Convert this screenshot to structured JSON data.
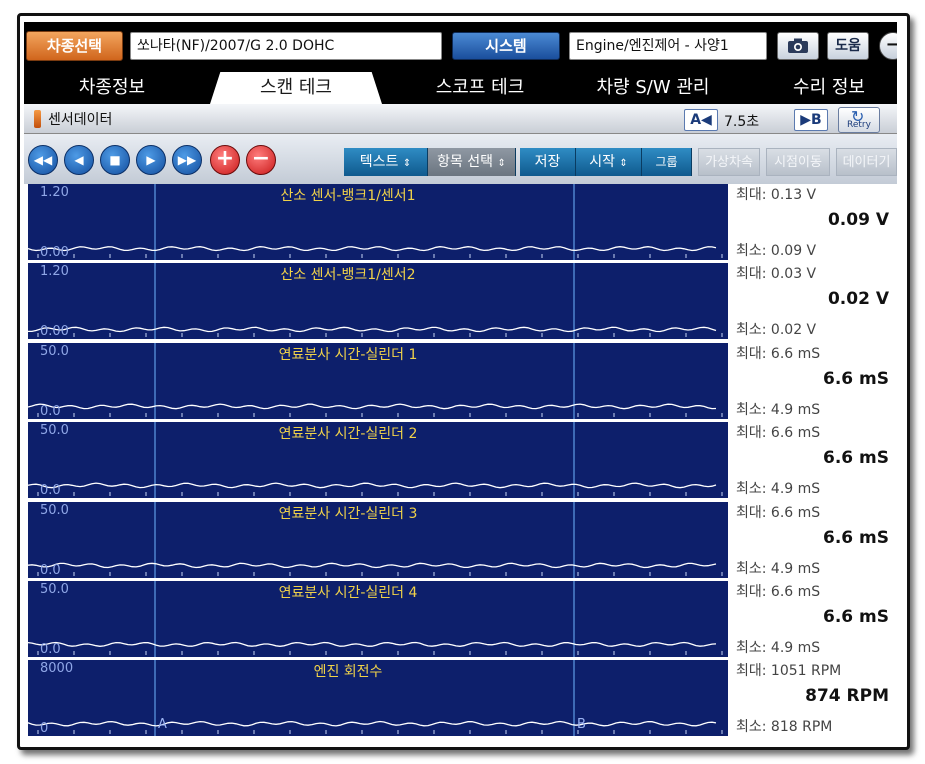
{
  "topbar": {
    "model_button": "차종선택",
    "vehicle": "쏘나타(NF)/2007/G 2.0 DOHC",
    "system_button": "시스템",
    "system_field": "Engine/엔진제어 - 사양1",
    "camera_icon": "camera-icon",
    "help_icon": "도움"
  },
  "tabs": [
    {
      "label": "차종정보"
    },
    {
      "label": "스캔 테크"
    },
    {
      "label": "스코프 테크"
    },
    {
      "label": "차량 S/W 관리"
    },
    {
      "label": "수리 정보"
    }
  ],
  "active_tab": 1,
  "sensorbar": {
    "title": "센서데이터",
    "cursor_a": "A◀",
    "time": "7.5초",
    "cursor_b": "▶B",
    "retry": "Retry"
  },
  "controls": {
    "text_button": "텍스트",
    "item_select": "항목 선택",
    "save": "저장",
    "start": "시작",
    "group": "그룹",
    "virtual_speed": "가상차속",
    "time_move": "시점이동",
    "data": "데이터기"
  },
  "cursor_labels": {
    "a": "A",
    "b": "B"
  },
  "chart_data": [
    {
      "type": "line",
      "title": "산소 센서-뱅크1/센서1",
      "ylim": [
        0.0,
        1.2
      ],
      "ymax_label": "1.20",
      "ymin_label": "0.00",
      "max": "최대:  0.13 V",
      "min": "최소:  0.09 V",
      "current": "0.09 V",
      "level": 0.08
    },
    {
      "type": "line",
      "title": "산소 센서-뱅크1/센서2",
      "ylim": [
        0.0,
        1.2
      ],
      "ymax_label": "1.20",
      "ymin_label": "0.00",
      "max": "최대:  0.03 V",
      "min": "최소:  0.02 V",
      "current": "0.02 V",
      "level": 0.02
    },
    {
      "type": "line",
      "title": "연료분사 시간-실린더 1",
      "ylim": [
        0.0,
        50.0
      ],
      "ymax_label": "50.0",
      "ymin_label": "0.0",
      "max": "최대:   6.6 mS",
      "min": "최소:   4.9 mS",
      "current": "6.6 mS",
      "level": 0.12
    },
    {
      "type": "line",
      "title": "연료분사 시간-실린더 2",
      "ylim": [
        0.0,
        50.0
      ],
      "ymax_label": "50.0",
      "ymin_label": "0.0",
      "max": "최대:   6.6 mS",
      "min": "최소:   4.9 mS",
      "current": "6.6 mS",
      "level": 0.12
    },
    {
      "type": "line",
      "title": "연료분사 시간-실린더 3",
      "ylim": [
        0.0,
        50.0
      ],
      "ymax_label": "50.0",
      "ymin_label": "0.0",
      "max": "최대:   6.6 mS",
      "min": "최소:   4.9 mS",
      "current": "6.6 mS",
      "level": 0.12
    },
    {
      "type": "line",
      "title": "연료분사 시간-실린더 4",
      "ylim": [
        0.0,
        50.0
      ],
      "ymax_label": "50.0",
      "ymin_label": "0.0",
      "max": "최대:   6.6 mS",
      "min": "최소:   4.9 mS",
      "current": "6.6 mS",
      "level": 0.12
    },
    {
      "type": "line",
      "title": "엔진 회전수",
      "ylim": [
        0,
        8000
      ],
      "ymax_label": "8000",
      "ymin_label": "0",
      "max": "최대:  1051 RPM",
      "min": "최소:  818 RPM",
      "current": "874 RPM",
      "level": 0.11
    }
  ]
}
